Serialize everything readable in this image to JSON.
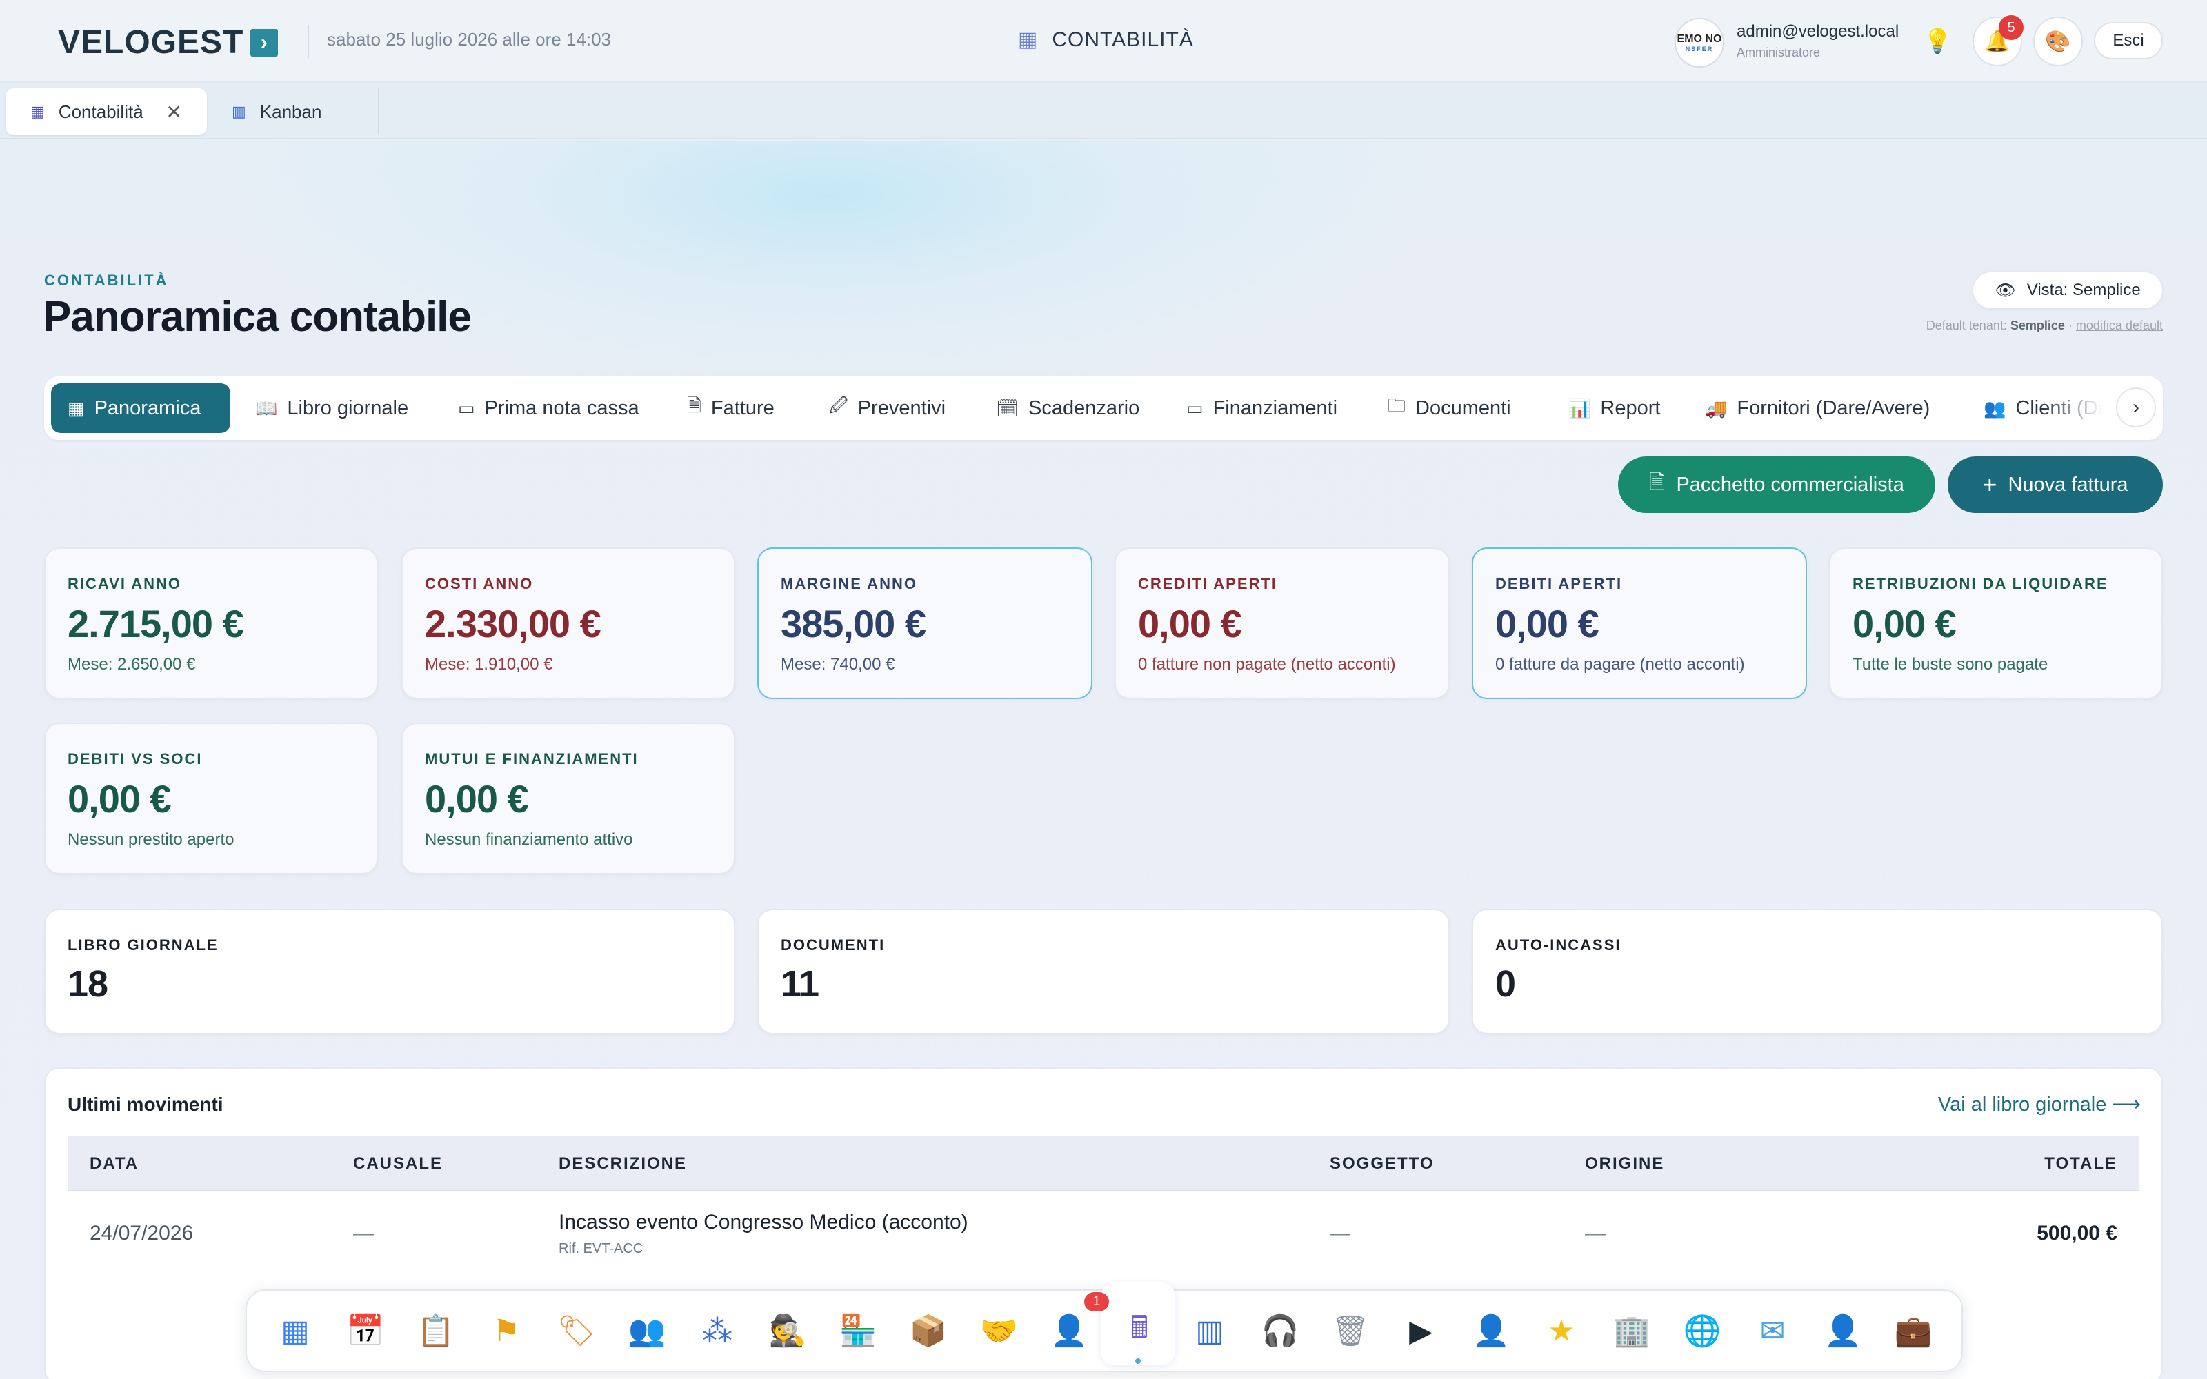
{
  "header": {
    "brand": "VELOGEST",
    "brand_arrow": "›",
    "datetime": "sabato 25 luglio 2026 alle ore 14:03",
    "module_title": "CONTABILITÀ",
    "avatar_text": "EMO NO",
    "avatar_sub": "NSFER",
    "user_email": "admin@velogest.local",
    "user_role": "Amministratore",
    "notifications_count": "5",
    "logout_label": "Esci"
  },
  "window_tabs": [
    {
      "label": "Contabilità",
      "icon": "calculator-icon"
    },
    {
      "label": "Kanban",
      "icon": "kanban-icon"
    }
  ],
  "page": {
    "eyebrow": "CONTABILITÀ",
    "title": "Panoramica contabile",
    "view_label": "Vista: Semplice",
    "default_tenant_label": "Default tenant:",
    "default_tenant_value": "Semplice",
    "default_tenant_sep": " · ",
    "modify_default_label": "modifica default"
  },
  "nav_tabs": [
    {
      "label": "Panoramica",
      "icon": "grid-icon",
      "active": true
    },
    {
      "label": "Libro giornale",
      "icon": "book-icon"
    },
    {
      "label": "Prima nota cassa",
      "icon": "wallet-icon"
    },
    {
      "label": "Fatture",
      "icon": "document-icon"
    },
    {
      "label": "Preventivi",
      "icon": "file-edit-icon"
    },
    {
      "label": "Scadenzario",
      "icon": "calendar-clock-icon"
    },
    {
      "label": "Finanziamenti",
      "icon": "banknote-icon"
    },
    {
      "label": "Documenti",
      "icon": "folder-icon"
    },
    {
      "label": "Report",
      "icon": "bar-chart-icon"
    },
    {
      "label": "Fornitori (Dare/Avere)",
      "icon": "truck-icon"
    },
    {
      "label": "Clienti (Dar",
      "icon": "users-icon"
    }
  ],
  "actions": {
    "pacchetto": "Pacchetto commercialista",
    "nuova_fattura": "Nuova fattura"
  },
  "kpi_cards": [
    {
      "label": "RICAVI ANNO",
      "value": "2.715,00 €",
      "sub": "Mese: 2.650,00 €",
      "tone": "green"
    },
    {
      "label": "COSTI ANNO",
      "value": "2.330,00 €",
      "sub": "Mese: 1.910,00 €",
      "tone": "red"
    },
    {
      "label": "MARGINE ANNO",
      "value": "385,00 €",
      "sub": "Mese: 740,00 €",
      "tone": "navy"
    },
    {
      "label": "CREDITI APERTI",
      "value": "0,00 €",
      "sub": "0 fatture non pagate (netto acconti)",
      "tone": "red"
    },
    {
      "label": "DEBITI APERTI",
      "value": "0,00 €",
      "sub": "0 fatture da pagare (netto acconti)",
      "tone": "navy"
    },
    {
      "label": "RETRIBUZIONI DA LIQUIDARE",
      "value": "0,00 €",
      "sub": "Tutte le buste sono pagate",
      "tone": "green"
    },
    {
      "label": "DEBITI VS SOCI",
      "value": "0,00 €",
      "sub": "Nessun prestito aperto",
      "tone": "green"
    },
    {
      "label": "MUTUI E FINANZIAMENTI",
      "value": "0,00 €",
      "sub": "Nessun finanziamento attivo",
      "tone": "green"
    }
  ],
  "count_cards": [
    {
      "label": "LIBRO GIORNALE",
      "value": "18"
    },
    {
      "label": "DOCUMENTI",
      "value": "11"
    },
    {
      "label": "AUTO-INCASSI",
      "value": "0"
    }
  ],
  "movements": {
    "title": "Ultimi movimenti",
    "link": "Vai al libro giornale ⟶",
    "columns": [
      "DATA",
      "CAUSALE",
      "DESCRIZIONE",
      "SOGGETTO",
      "ORIGINE",
      "TOTALE"
    ],
    "rows": [
      {
        "data": "24/07/2026",
        "causale": "—",
        "descrizione": "Incasso evento Congresso Medico (acconto)",
        "rif": "Rif. EVT-ACC",
        "soggetto": "—",
        "origine": "—",
        "totale": "500,00 €"
      }
    ]
  },
  "dock": {
    "badge": "1",
    "items": [
      {
        "name": "apps-icon",
        "glyph": "▦",
        "color": "#3b82f6"
      },
      {
        "name": "calendar-icon",
        "glyph": "📅",
        "color": "#e04848"
      },
      {
        "name": "clipboard-check-icon",
        "glyph": "📋",
        "color": "#2f7de0"
      },
      {
        "name": "flag-icon",
        "glyph": "⚑",
        "color": "#e8a416"
      },
      {
        "name": "tag-icon",
        "glyph": "🏷",
        "color": "#f08c2a"
      },
      {
        "name": "users-icon",
        "glyph": "👥",
        "color": "#3b82f6"
      },
      {
        "name": "network-icon",
        "glyph": "⁂",
        "color": "#3b6fd4"
      },
      {
        "name": "spy-icon",
        "glyph": "🕵",
        "color": "#1e2a3a"
      },
      {
        "name": "store-icon",
        "glyph": "🏪",
        "color": "#d84a4a"
      },
      {
        "name": "package-icon",
        "glyph": "📦",
        "color": "#e8a03a"
      },
      {
        "name": "handshake-icon",
        "glyph": "🤝",
        "color": "#1fa58a"
      },
      {
        "name": "cashier-icon",
        "glyph": "👤",
        "color": "#3b5fd4"
      },
      {
        "name": "calculator-icon",
        "glyph": "🖩",
        "color": "#6a5ad6"
      },
      {
        "name": "kanban-icon",
        "glyph": "▥",
        "color": "#2f6ed8"
      },
      {
        "name": "headset-icon",
        "glyph": "🎧",
        "color": "#2e8fd8"
      },
      {
        "name": "trash-icon",
        "glyph": "🗑",
        "color": "#8a94a2"
      },
      {
        "name": "terminal-icon",
        "glyph": "▶",
        "color": "#1e2a33"
      },
      {
        "name": "user-add-icon",
        "glyph": "👤",
        "color": "#6a5ad6"
      },
      {
        "name": "star-icon",
        "glyph": "★",
        "color": "#f2c21b"
      },
      {
        "name": "building-icon",
        "glyph": "🏢",
        "color": "#2f6ed8"
      },
      {
        "name": "globe-icon",
        "glyph": "🌐",
        "color": "#2e8fd8"
      },
      {
        "name": "mail-icon",
        "glyph": "✉",
        "color": "#4aa3e0"
      },
      {
        "name": "user-settings-icon",
        "glyph": "👤",
        "color": "#6a5ad6"
      },
      {
        "name": "briefcase-icon",
        "glyph": "💼",
        "color": "#7a5ad6"
      }
    ]
  }
}
